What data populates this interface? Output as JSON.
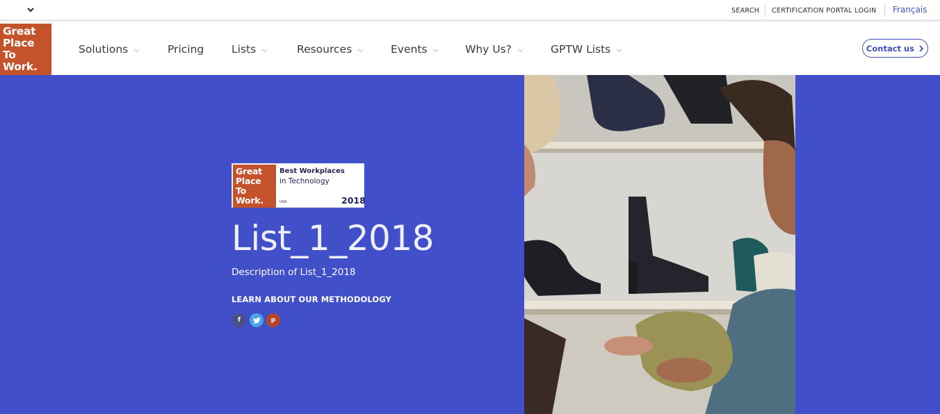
{
  "utility_bar": {
    "search_label": "SEARCH",
    "cert_label": "CERTIFICATION PORTAL LOGIN",
    "language_label": "Français"
  },
  "logo": {
    "lines": [
      "Great",
      "Place",
      "To",
      "Work."
    ]
  },
  "nav": {
    "items": [
      {
        "label": "Solutions",
        "has_dropdown": true
      },
      {
        "label": "Pricing",
        "has_dropdown": false
      },
      {
        "label": "Lists",
        "has_dropdown": true
      },
      {
        "label": "Resources",
        "has_dropdown": true
      },
      {
        "label": "Events",
        "has_dropdown": true
      },
      {
        "label": "Why Us?",
        "has_dropdown": true
      },
      {
        "label": "GPTW Lists",
        "has_dropdown": true
      }
    ],
    "contact_label": "Contact us"
  },
  "hero": {
    "badge": {
      "logo_lines": [
        "Great",
        "Place",
        "To",
        "Work."
      ],
      "line1": "Best Workplaces",
      "line2": "in Technology",
      "country": "USA",
      "year": "2018"
    },
    "title": "List_1_2018",
    "description": "Description of List_1_2018",
    "link_label": "LEARN ABOUT OUR METHODOLOGY",
    "social": [
      {
        "icon": "facebook-icon",
        "glyph": "f"
      },
      {
        "icon": "twitter-icon",
        "glyph": "t"
      },
      {
        "icon": "pinterest-icon",
        "glyph": "p"
      }
    ]
  },
  "colors": {
    "hero_bg": "#4150c8",
    "brand_orange": "#c4522a",
    "accent_blue": "#3f4fc0"
  }
}
